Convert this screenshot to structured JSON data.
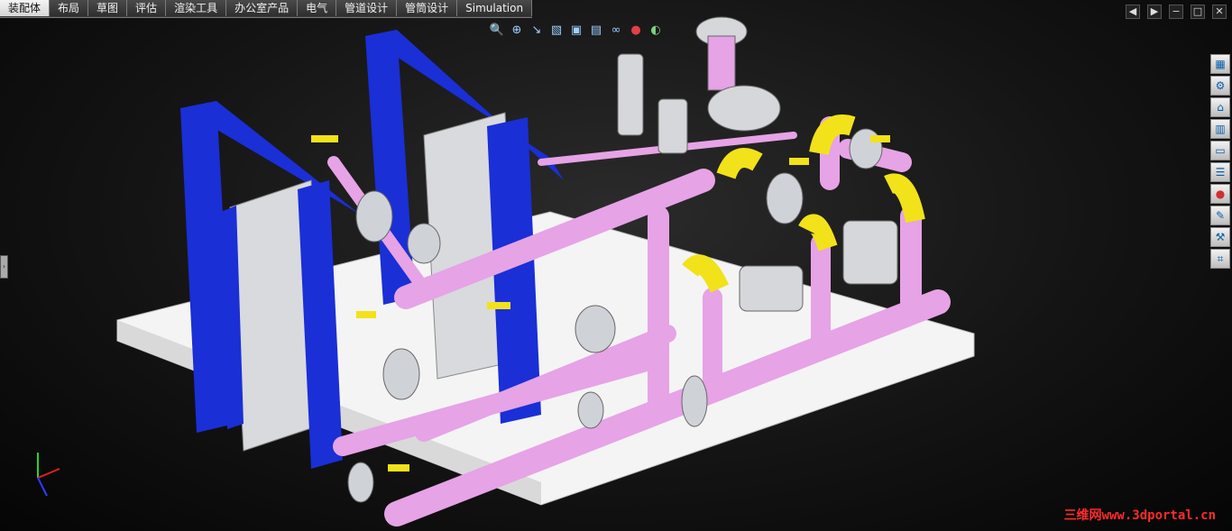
{
  "command_manager": {
    "tabs": [
      {
        "label": "装配体",
        "active": true
      },
      {
        "label": "布局",
        "active": false
      },
      {
        "label": "草图",
        "active": false
      },
      {
        "label": "评估",
        "active": false
      },
      {
        "label": "渲染工具",
        "active": false
      },
      {
        "label": "办公室产品",
        "active": false
      },
      {
        "label": "电气",
        "active": false
      },
      {
        "label": "管道设计",
        "active": false
      },
      {
        "label": "管筒设计",
        "active": false
      },
      {
        "label": "Simulation",
        "active": false
      }
    ]
  },
  "headsup_toolbar": [
    "zoom-to-fit-icon",
    "zoom-to-area-icon",
    "previous-view-icon",
    "section-view-icon",
    "view-orientation-icon",
    "display-style-icon",
    "hide-show-icon",
    "edit-appearance-icon",
    "apply-scene-icon"
  ],
  "window_controls": [
    "prev-icon",
    "next-icon",
    "minimize-icon",
    "restore-icon",
    "close-icon"
  ],
  "task_pane": [
    "solidworks-resources-icon",
    "design-library-icon",
    "file-explorer-icon",
    "view-palette-icon",
    "folder-icon",
    "custom-properties-icon",
    "appearances-icon",
    "document-recovery-icon",
    "toolbox-icon",
    "routing-library-icon"
  ],
  "colors": {
    "frame_blue": "#1a2fd6",
    "pipe_pink": "#e6a3e6",
    "elbow_yellow": "#f2e21a",
    "base_white": "#f2f2f2",
    "valve_gray": "#cfd3d8"
  },
  "watermark": "三维网www.3dportal.cn"
}
